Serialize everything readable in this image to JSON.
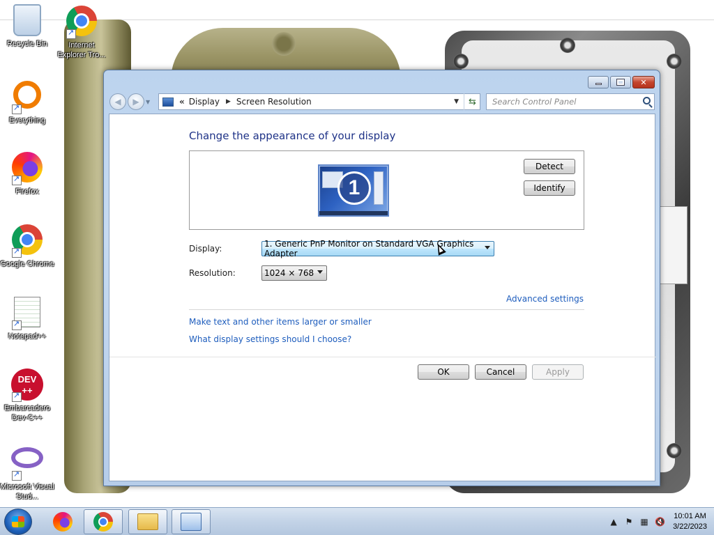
{
  "desktop": {
    "icons": [
      {
        "label": "Recycle Bin",
        "icon": "recycle-bin-icon"
      },
      {
        "label": "Internet Explorer Tro...",
        "icon": "chrome-icon"
      },
      {
        "label": "Everything",
        "icon": "everything-icon"
      },
      {
        "label": "Firefox",
        "icon": "firefox-icon"
      },
      {
        "label": "Google Chrome",
        "icon": "chrome-icon"
      },
      {
        "label": "Notepad++",
        "icon": "notepad-plus-plus-icon"
      },
      {
        "label": "Embarcadero Dev-C++",
        "icon": "dev-cpp-icon"
      },
      {
        "label": "Microsoft Visual Stud...",
        "icon": "visual-studio-icon"
      }
    ],
    "dev_logo_text": "DEV",
    "dev_logo_sub": "++"
  },
  "window": {
    "breadcrumb": {
      "overflow": "«",
      "items": [
        "Display",
        "Screen Resolution"
      ]
    },
    "search_placeholder": "Search Control Panel",
    "title": "Change the appearance of your display",
    "monitor_number": "1",
    "detect_label": "Detect",
    "identify_label": "Identify",
    "display_label": "Display:",
    "display_value": "1. Generic PnP Monitor on Standard VGA Graphics Adapter",
    "resolution_label": "Resolution:",
    "resolution_value": "1024 × 768",
    "advanced_link": "Advanced settings",
    "link_text_size": "Make text and other items larger or smaller",
    "link_help": "What display settings should I choose?",
    "ok_label": "OK",
    "cancel_label": "Cancel",
    "apply_label": "Apply"
  },
  "taskbar": {
    "time": "10:01 AM",
    "date": "3/22/2023"
  }
}
